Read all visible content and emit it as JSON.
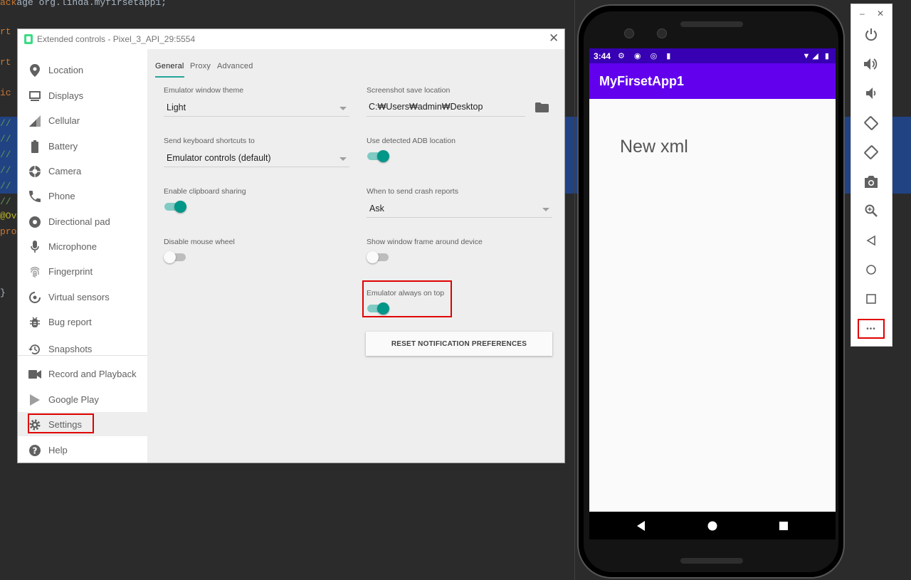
{
  "ide": {
    "line_package": "age org.linda.myfirsetapp1;",
    "line_import1": "rt a",
    "line_import2": "rt a",
    "line_class": "ic c",
    "comment_lines": [
      "//",
      "//",
      "//",
      "//",
      "//",
      "//"
    ],
    "annotation": "@Ov",
    "protected": "prot",
    "brace": "}"
  },
  "ext_window": {
    "title": "Extended controls - Pixel_3_API_29:5554",
    "close_glyph": "✕"
  },
  "sidebar": {
    "items": [
      {
        "label": "Location",
        "icon": "location-pin-icon"
      },
      {
        "label": "Displays",
        "icon": "display-icon"
      },
      {
        "label": "Cellular",
        "icon": "cellular-signal-icon"
      },
      {
        "label": "Battery",
        "icon": "battery-icon"
      },
      {
        "label": "Camera",
        "icon": "camera-aperture-icon"
      },
      {
        "label": "Phone",
        "icon": "phone-icon"
      },
      {
        "label": "Directional pad",
        "icon": "dpad-icon"
      },
      {
        "label": "Microphone",
        "icon": "microphone-icon"
      },
      {
        "label": "Fingerprint",
        "icon": "fingerprint-icon"
      },
      {
        "label": "Virtual sensors",
        "icon": "sensors-icon"
      },
      {
        "label": "Bug report",
        "icon": "bug-icon"
      },
      {
        "label": "Snapshots",
        "icon": "history-icon"
      },
      {
        "label": "Record and Playback",
        "icon": "video-camera-icon"
      },
      {
        "label": "Google Play",
        "icon": "play-store-icon"
      },
      {
        "label": "Settings",
        "icon": "gear-icon"
      },
      {
        "label": "Help",
        "icon": "help-icon"
      }
    ],
    "active": "Settings"
  },
  "tabs": [
    {
      "label": "General",
      "active": true
    },
    {
      "label": "Proxy",
      "active": false
    },
    {
      "label": "Advanced",
      "active": false
    }
  ],
  "settings": {
    "theme_label": "Emulator window theme",
    "theme_value": "Light",
    "screenshot_label": "Screenshot save location",
    "screenshot_value": "C:₩Users₩admin₩Desktop",
    "shortcuts_label": "Send keyboard shortcuts to",
    "shortcuts_value": "Emulator controls (default)",
    "adb_label": "Use detected ADB location",
    "adb_on": true,
    "clipboard_label": "Enable clipboard sharing",
    "clipboard_on": true,
    "crash_label": "When to send crash reports",
    "crash_value": "Ask",
    "mousewheel_label": "Disable mouse wheel",
    "mousewheel_on": false,
    "frame_label": "Show window frame around device",
    "frame_on": false,
    "ontop_label": "Emulator always on top",
    "ontop_on": true,
    "reset_button": "RESET NOTIFICATION PREFERENCES"
  },
  "phone": {
    "time": "3:44",
    "status_icons": "⚙ ◉ ◎ ▮",
    "right_icons": "▼◢ ▮",
    "app_title": "MyFirsetApp1",
    "content_text": "New xml"
  },
  "toolbar": {
    "minimize": "–",
    "close": "✕",
    "buttons": [
      "power-icon",
      "volume-up-icon",
      "volume-down-icon",
      "rotate-left-icon",
      "rotate-right-icon",
      "camera-icon",
      "zoom-icon",
      "back-icon",
      "home-icon",
      "overview-icon",
      "more-icon"
    ],
    "more_glyph": "•••"
  },
  "colors": {
    "accent_teal": "#009688",
    "highlight_red": "#e00000",
    "app_purple": "#6200ee",
    "status_purple": "#3700b3"
  }
}
